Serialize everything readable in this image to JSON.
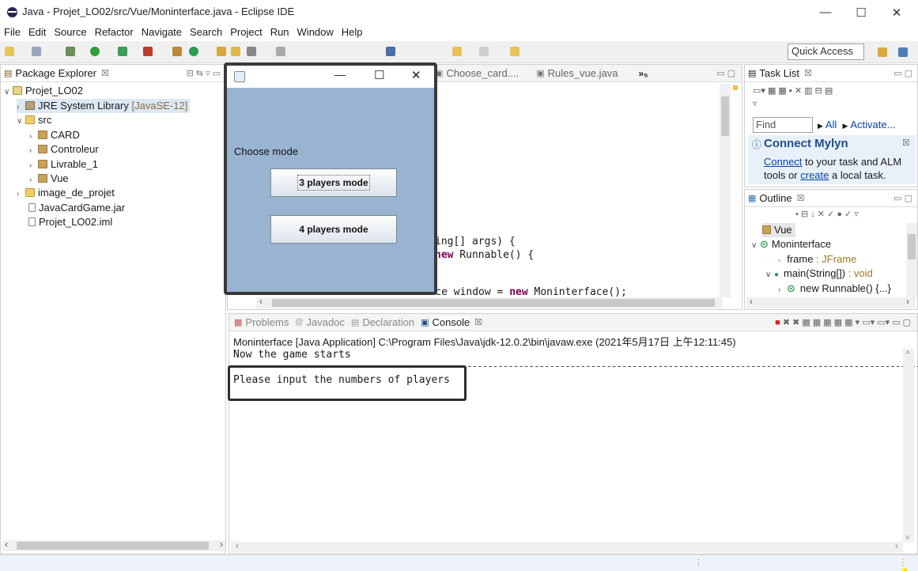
{
  "window": {
    "title": "Java - Projet_LO02/src/Vue/Moninterface.java - Eclipse IDE",
    "minimize": "—",
    "maximize": "☐",
    "close": "✕"
  },
  "menu": [
    "File",
    "Edit",
    "Source",
    "Refactor",
    "Navigate",
    "Search",
    "Project",
    "Run",
    "Window",
    "Help"
  ],
  "toolbar": {
    "quick_access": "Quick Access"
  },
  "package_explorer": {
    "tab": "Package Explorer",
    "close_glyph": "☒",
    "tree": [
      {
        "label": "Projet_LO02"
      },
      {
        "label": "JRE System Library",
        "suffix": "[JavaSE-12]"
      },
      {
        "label": "src"
      },
      {
        "label": "CARD"
      },
      {
        "label": "Controleur"
      },
      {
        "label": "Livrable_1"
      },
      {
        "label": "Vue"
      },
      {
        "label": "image_de_projet"
      },
      {
        "label": "JavaCardGame.jar"
      },
      {
        "label": "Projet_LO02.iml"
      }
    ]
  },
  "editor": {
    "tabs": [
      {
        "label": "Choose_card...."
      },
      {
        "label": "Rules_vue.java"
      },
      {
        "label": "»₅"
      }
    ],
    "code": {
      "line1": "ing[] args) {",
      "line2_kw": "new",
      "line2": " Runnable() {",
      "line3_a": "Moninterface window = ",
      "line3_kw": "new",
      "line3_b": " Moninterface();"
    }
  },
  "task_list": {
    "tab": "Task List",
    "find_placeholder": "Find",
    "all": "All",
    "activate": "Activate...",
    "mylyn_title": "Connect Mylyn",
    "mylyn_text_1": "Connect",
    "mylyn_text_2": " to your task and ALM",
    "mylyn_text_3": "tools or ",
    "mylyn_text_4": "create",
    "mylyn_text_5": " a local task."
  },
  "outline": {
    "tab": "Outline",
    "items": [
      {
        "label": "Vue"
      },
      {
        "label": "Moninterface"
      },
      {
        "label": "frame",
        "type": " : JFrame"
      },
      {
        "label": "main(String[])",
        "type": " : void"
      },
      {
        "label": "new Runnable() {...}"
      }
    ]
  },
  "console": {
    "tabs": [
      "Problems",
      "Javadoc",
      "Declaration",
      "Console"
    ],
    "header": "Moninterface [Java Application] C:\\Program Files\\Java\\jdk-12.0.2\\bin\\javaw.exe (2021年5月17日 上午12:11:45)",
    "line1": "Now the game starts",
    "line2": "-----------------------------------------------------------------------------------------",
    "line3": "Please input the numbers of players"
  },
  "dialog": {
    "prompt": "Choose mode",
    "button_3": "3 players mode",
    "button_4": "4 players mode",
    "minimize": "—",
    "maximize": "☐",
    "close": "✕"
  }
}
